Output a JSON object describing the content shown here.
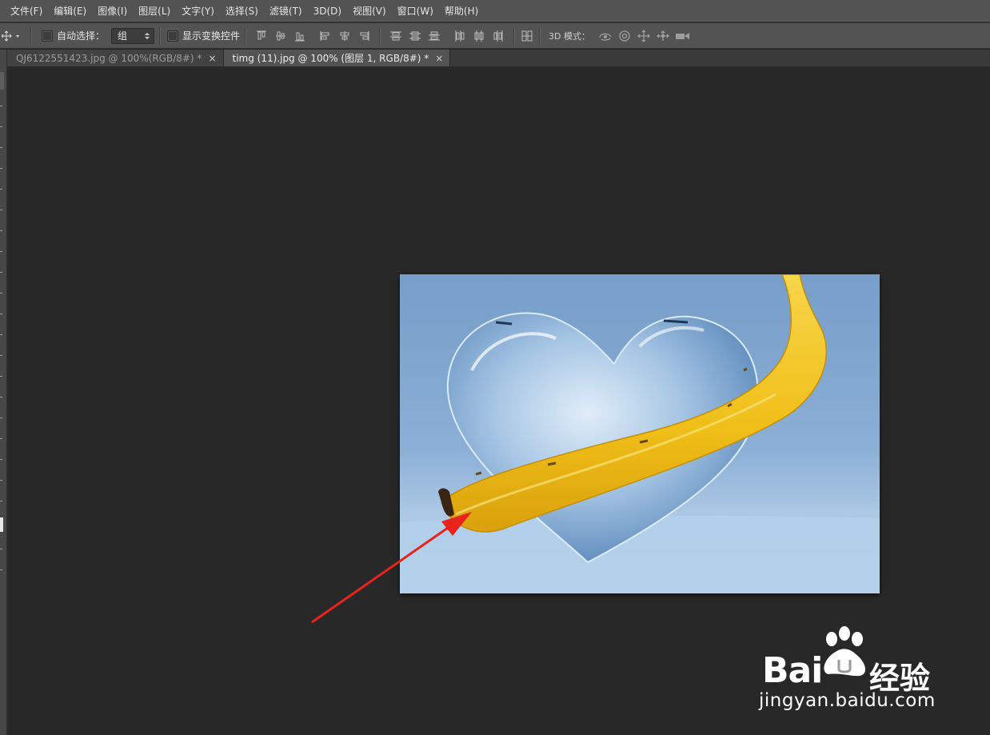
{
  "menu": {
    "items": [
      "文件(F)",
      "编辑(E)",
      "图像(I)",
      "图层(L)",
      "文字(Y)",
      "选择(S)",
      "滤镜(T)",
      "3D(D)",
      "视图(V)",
      "窗口(W)",
      "帮助(H)"
    ]
  },
  "options": {
    "auto_select_label": "自动选择：",
    "auto_select_value": "组",
    "show_transform_label": "显示变换控件",
    "mode3d_label": "3D 模式："
  },
  "tabs": [
    {
      "label": "QJ6122551423.jpg @ 100%(RGB/8#) *",
      "close": "×"
    },
    {
      "label": "timg (11).jpg @ 100% (图层 1, RGB/8#) *",
      "close": "×"
    }
  ],
  "watermark": {
    "brand": "Bai",
    "product": "经验",
    "url": "jingyan.baidu.com"
  },
  "colors": {
    "annotation_arrow": "#e8231b",
    "banana": "#f2c21b",
    "ice_background": "#7fa8d3"
  }
}
